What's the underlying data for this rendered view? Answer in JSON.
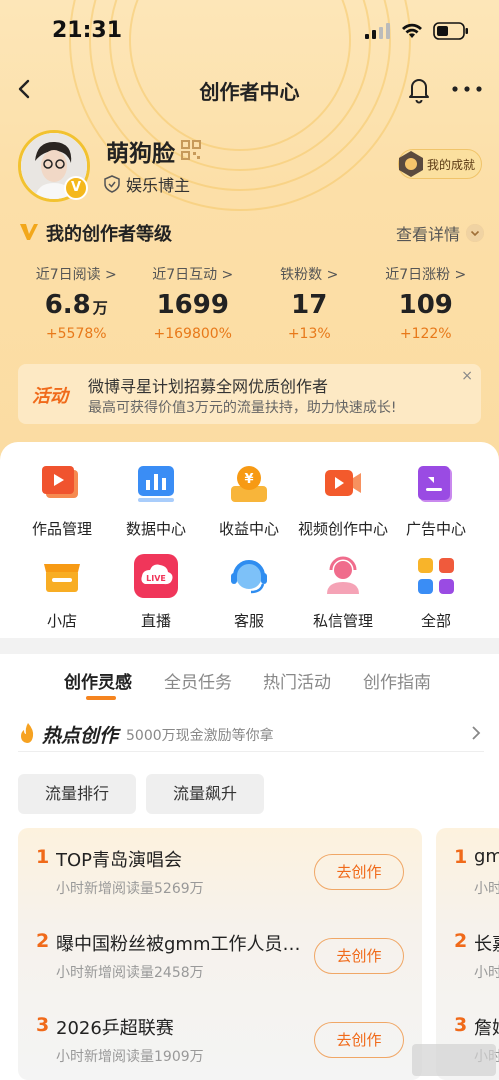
{
  "status_bar": {
    "time": "21:31"
  },
  "nav": {
    "title": "创作者中心"
  },
  "profile": {
    "username": "萌狗脸",
    "role": "娱乐博主",
    "verified_mark": "V",
    "achievement_label": "我的成就"
  },
  "level": {
    "title": "我的创作者等级",
    "link": "查看详情"
  },
  "stats": [
    {
      "label": "近7日阅读 >",
      "value": "6.8",
      "unit": "万",
      "change": "+5578%"
    },
    {
      "label": "近7日互动 >",
      "value": "1699",
      "unit": "",
      "change": "+169800%"
    },
    {
      "label": "铁粉数 >",
      "value": "17",
      "unit": "",
      "change": "+13%"
    },
    {
      "label": "近7日涨粉 >",
      "value": "109",
      "unit": "",
      "change": "+122%"
    }
  ],
  "banner": {
    "tag": "活动",
    "title": "微博寻星计划招募全网优质创作者",
    "subtitle": "最高可获得价值3万元的流量扶持，助力快速成长!",
    "close": "×"
  },
  "tools": [
    {
      "label": "作品管理",
      "icon": "works-icon"
    },
    {
      "label": "数据中心",
      "icon": "data-center-icon"
    },
    {
      "label": "收益中心",
      "icon": "income-icon"
    },
    {
      "label": "视频创作中心",
      "icon": "video-creation-icon"
    },
    {
      "label": "广告中心",
      "icon": "ad-center-icon"
    },
    {
      "label": "小店",
      "icon": "shop-icon"
    },
    {
      "label": "直播",
      "icon": "live-icon",
      "badge": "LIVE"
    },
    {
      "label": "客服",
      "icon": "customer-service-icon"
    },
    {
      "label": "私信管理",
      "icon": "message-manage-icon"
    },
    {
      "label": "全部",
      "icon": "all-grid-icon"
    }
  ],
  "tabs": [
    {
      "label": "创作灵感",
      "active": true
    },
    {
      "label": "全员任务",
      "active": false
    },
    {
      "label": "热门活动",
      "active": false
    },
    {
      "label": "创作指南",
      "active": false
    }
  ],
  "hot": {
    "title": "热点创作",
    "subtitle": "5000万现金激励等你拿"
  },
  "chips": [
    "流量排行",
    "流量飙升"
  ],
  "ranking": [
    {
      "rank": "1",
      "title": "TOP青岛演唱会",
      "sub": "小时新增阅读量5269万",
      "button": "去创作"
    },
    {
      "rank": "2",
      "title": "曝中国粉丝被gmm工作人员扇耳光",
      "sub": "小时新增阅读量2458万",
      "button": "去创作"
    },
    {
      "rank": "3",
      "title": "2026乒超联赛",
      "sub": "小时新增阅读量1909万",
      "button": "去创作"
    }
  ],
  "ranking_peek": [
    {
      "rank": "1",
      "title": "gm",
      "sub": "小时"
    },
    {
      "rank": "2",
      "title": "长嘉",
      "sub": "小时"
    },
    {
      "rank": "3",
      "title": "詹姆",
      "sub": "小时"
    }
  ],
  "colors": {
    "accent": "#f06a1a",
    "hero_bg": "#fde6b8",
    "change": "#e8791a"
  }
}
